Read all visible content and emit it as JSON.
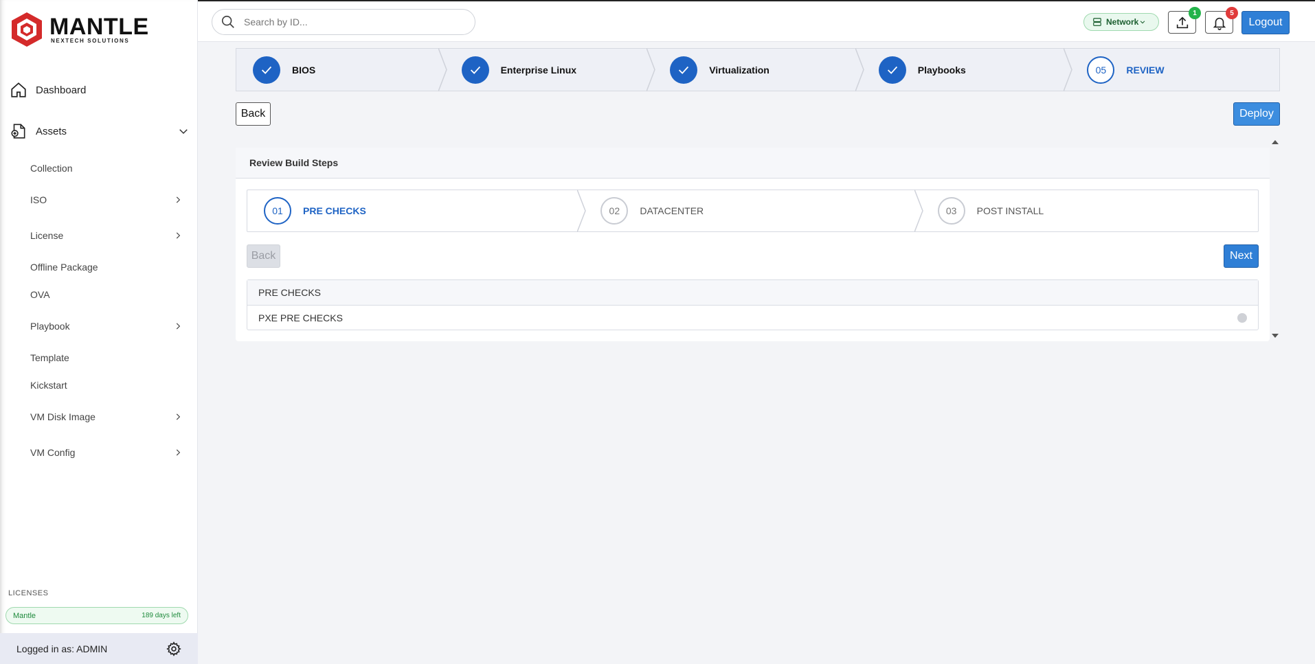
{
  "brand": {
    "name": "MANTLE",
    "tagline": "NEXTECH SOLUTIONS"
  },
  "search": {
    "placeholder": "Search by ID..."
  },
  "header": {
    "network_label": "Network",
    "upload_badge": "1",
    "notifications_badge": "5",
    "logout_label": "Logout"
  },
  "sidebar": {
    "dashboard_label": "Dashboard",
    "assets_label": "Assets",
    "asset_items": [
      {
        "label": "Collection",
        "has_submenu": false
      },
      {
        "label": "ISO",
        "has_submenu": true
      },
      {
        "label": "License",
        "has_submenu": true
      },
      {
        "label": "Offline Package",
        "has_submenu": false
      },
      {
        "label": "OVA",
        "has_submenu": false
      },
      {
        "label": "Playbook",
        "has_submenu": true
      },
      {
        "label": "Template",
        "has_submenu": false
      },
      {
        "label": "Kickstart",
        "has_submenu": false
      },
      {
        "label": "VM Disk Image",
        "has_submenu": true
      },
      {
        "label": "VM Config",
        "has_submenu": true
      }
    ],
    "licenses_title": "LICENSES",
    "license": {
      "name": "Mantle",
      "days_left": "189 days left"
    },
    "logged_in": "Logged in as: ADMIN"
  },
  "wizard": {
    "steps": [
      {
        "label": "BIOS",
        "state": "done"
      },
      {
        "label": "Enterprise Linux",
        "state": "done"
      },
      {
        "label": "Virtualization",
        "state": "done"
      },
      {
        "label": "Playbooks",
        "state": "done"
      },
      {
        "number": "05",
        "label": "REVIEW",
        "state": "active"
      }
    ],
    "back_label": "Back",
    "deploy_label": "Deploy"
  },
  "review": {
    "title": "Review Build Steps",
    "steps": [
      {
        "number": "01",
        "label": "PRE CHECKS",
        "state": "active"
      },
      {
        "number": "02",
        "label": "DATACENTER",
        "state": "pending"
      },
      {
        "number": "03",
        "label": "POST INSTALL",
        "state": "pending"
      }
    ],
    "back_label": "Back",
    "next_label": "Next",
    "section_title": "PRE CHECKS",
    "checks": [
      {
        "label": "PXE PRE CHECKS",
        "status": "pending"
      }
    ]
  },
  "colors": {
    "primary": "#1e63c4",
    "button": "#2f7fd6",
    "success": "#23b34a",
    "danger": "#e03b3b",
    "brand_red": "#d42a2a"
  }
}
